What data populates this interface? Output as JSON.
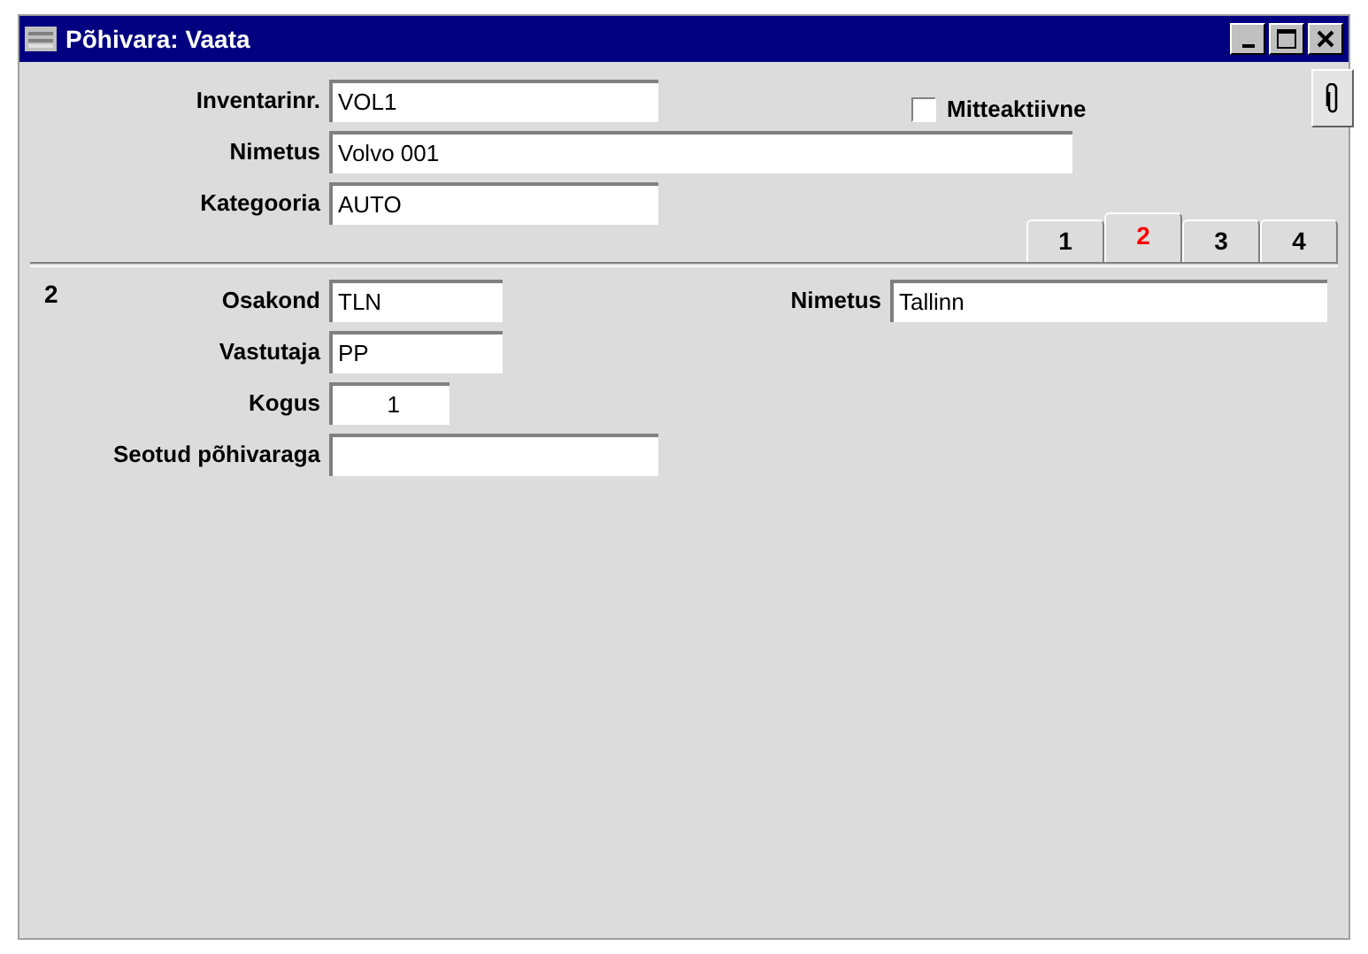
{
  "window": {
    "title": "Põhivara: Vaata"
  },
  "header_fields": [
    {
      "label": "Inventarinr.",
      "value": "VOL1"
    },
    {
      "label": "Nimetus",
      "value": "Volvo 001"
    },
    {
      "label": "Kategooria",
      "value": "AUTO"
    }
  ],
  "inactive": {
    "label": "Mitteaktiivne",
    "checked": false
  },
  "tabs": [
    {
      "label": "1",
      "selected": false
    },
    {
      "label": "2",
      "selected": true
    },
    {
      "label": "3",
      "selected": false
    },
    {
      "label": "4",
      "selected": false
    }
  ],
  "page_number": "2",
  "fields": [
    {
      "label": "Osakond",
      "value": "TLN",
      "kind": "text"
    },
    {
      "label": "Vastutaja",
      "value": "PP",
      "kind": "text"
    },
    {
      "label": "Kogus",
      "value": "1",
      "kind": "number"
    },
    {
      "label": "Seotud põhivaraga",
      "kind": "text"
    }
  ],
  "right_field": {
    "label": "Nimetus",
    "value": "Tallinn"
  }
}
